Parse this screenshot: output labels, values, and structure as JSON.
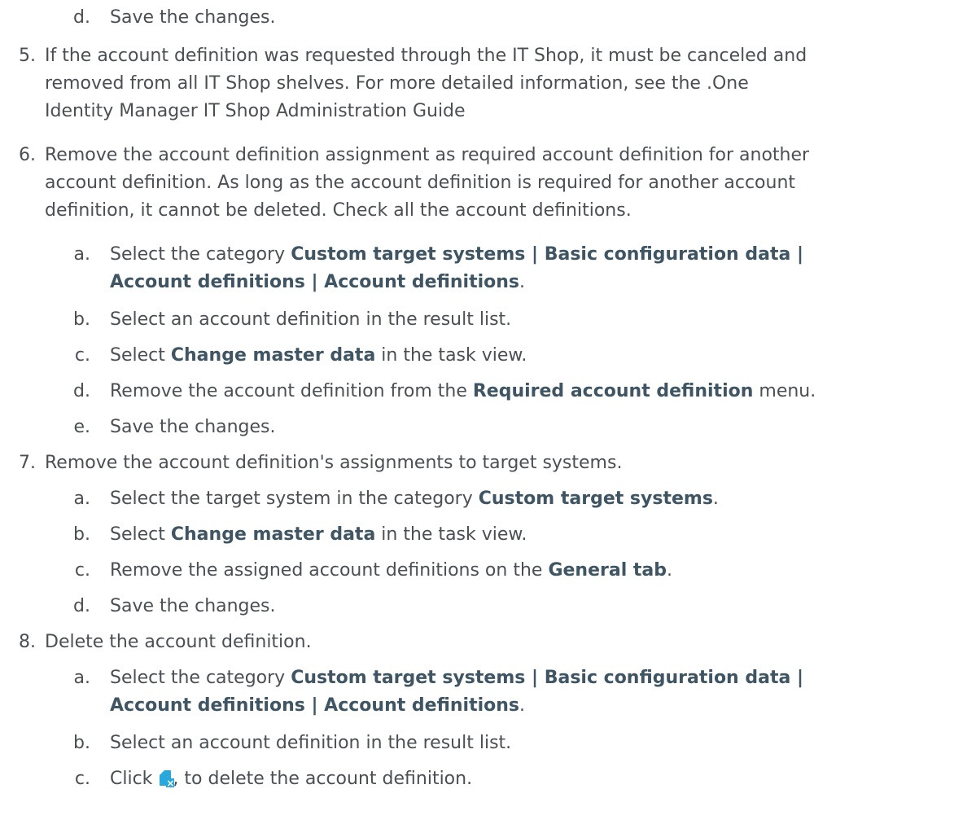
{
  "step4": {
    "d": {
      "marker": "d.",
      "text": "Save the changes."
    }
  },
  "step5": {
    "marker": "5.",
    "line1": "If the account definition was requested through the IT Shop, it must be canceled and",
    "line2": "removed from all IT Shop shelves. For more detailed information, see the .One",
    "line3": "Identity Manager IT Shop Administration Guide"
  },
  "step6": {
    "marker": "6.",
    "line1": "Remove the account definition assignment as required account definition for another",
    "line2": "account definition. As long as the account definition is required for another account",
    "line3": "definition, it cannot be deleted. Check all the account definitions.",
    "a": {
      "marker": "a.",
      "pre": "Select the category ",
      "bold1": "Custom target systems | Basic configuration data |",
      "bold2": "Account definitions | Account definitions",
      "post": "."
    },
    "b": {
      "marker": "b.",
      "text": "Select an account definition in the result list."
    },
    "c": {
      "marker": "c.",
      "pre": "Select ",
      "bold": "Change master data",
      "post": " in the task view."
    },
    "d": {
      "marker": "d.",
      "pre": "Remove the account definition from the ",
      "bold": "Required account definition",
      "post": " menu."
    },
    "e": {
      "marker": "e.",
      "text": "Save the changes."
    }
  },
  "step7": {
    "marker": "7.",
    "text": "Remove the account definition's assignments to target systems.",
    "a": {
      "marker": "a.",
      "pre": "Select the target system in the category ",
      "bold": "Custom target systems",
      "post": "."
    },
    "b": {
      "marker": "b.",
      "pre": "Select ",
      "bold": "Change master data",
      "post": " in the task view."
    },
    "c": {
      "marker": "c.",
      "pre": "Remove the assigned account definitions on the ",
      "bold": "General tab",
      "post": "."
    },
    "d": {
      "marker": "d.",
      "text": "Save the changes."
    }
  },
  "step8": {
    "marker": "8.",
    "text": "Delete the account definition.",
    "a": {
      "marker": "a.",
      "pre": "Select the category ",
      "bold1": "Custom target systems | Basic configuration data |",
      "bold2": "Account definitions | Account definitions",
      "post": "."
    },
    "b": {
      "marker": "b.",
      "text": "Select an account definition in the result list."
    },
    "c": {
      "marker": "c.",
      "pre": "Click ",
      "icon": "delete-document-icon",
      "post": ", to delete the account definition."
    }
  },
  "colors": {
    "body_text": "#4b4f54",
    "bold_text": "#3f5563",
    "icon_blue": "#2aa8dc"
  }
}
